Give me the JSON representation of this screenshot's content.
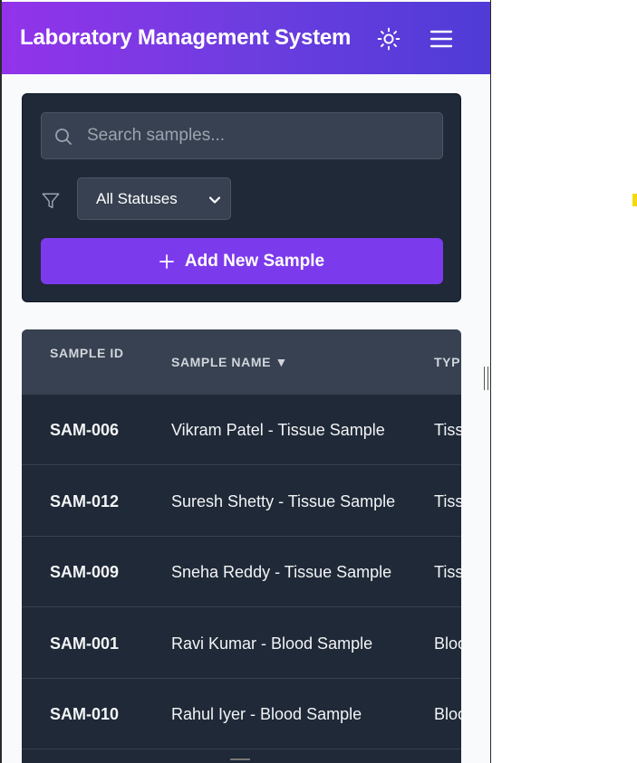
{
  "header": {
    "title": "Laboratory Management System",
    "theme_icon": "sun-icon",
    "menu_icon": "hamburger-menu-icon"
  },
  "controls": {
    "search": {
      "placeholder": "Search samples...",
      "value": ""
    },
    "filter": {
      "icon": "filter-icon",
      "selected": "All Statuses"
    },
    "add_button_label": "Add New Sample"
  },
  "table": {
    "columns": [
      "SAMPLE ID",
      "SAMPLE NAME ▼",
      "TYP"
    ],
    "rows": [
      {
        "id": "SAM-006",
        "name": "Vikram Patel - Tissue Sample",
        "type": "Tissu"
      },
      {
        "id": "SAM-012",
        "name": "Suresh Shetty - Tissue Sample",
        "type": "Tissu"
      },
      {
        "id": "SAM-009",
        "name": "Sneha Reddy - Tissue Sample",
        "type": "Tissu"
      },
      {
        "id": "SAM-001",
        "name": "Ravi Kumar - Blood Sample",
        "type": "Blood"
      },
      {
        "id": "SAM-010",
        "name": "Rahul Iyer - Blood Sample",
        "type": "Blood"
      }
    ]
  },
  "colors": {
    "header_gradient_start": "#9333ea",
    "header_gradient_end": "#4f3bd6",
    "panel_bg": "#1f2937",
    "accent_button": "#7c3aed"
  }
}
